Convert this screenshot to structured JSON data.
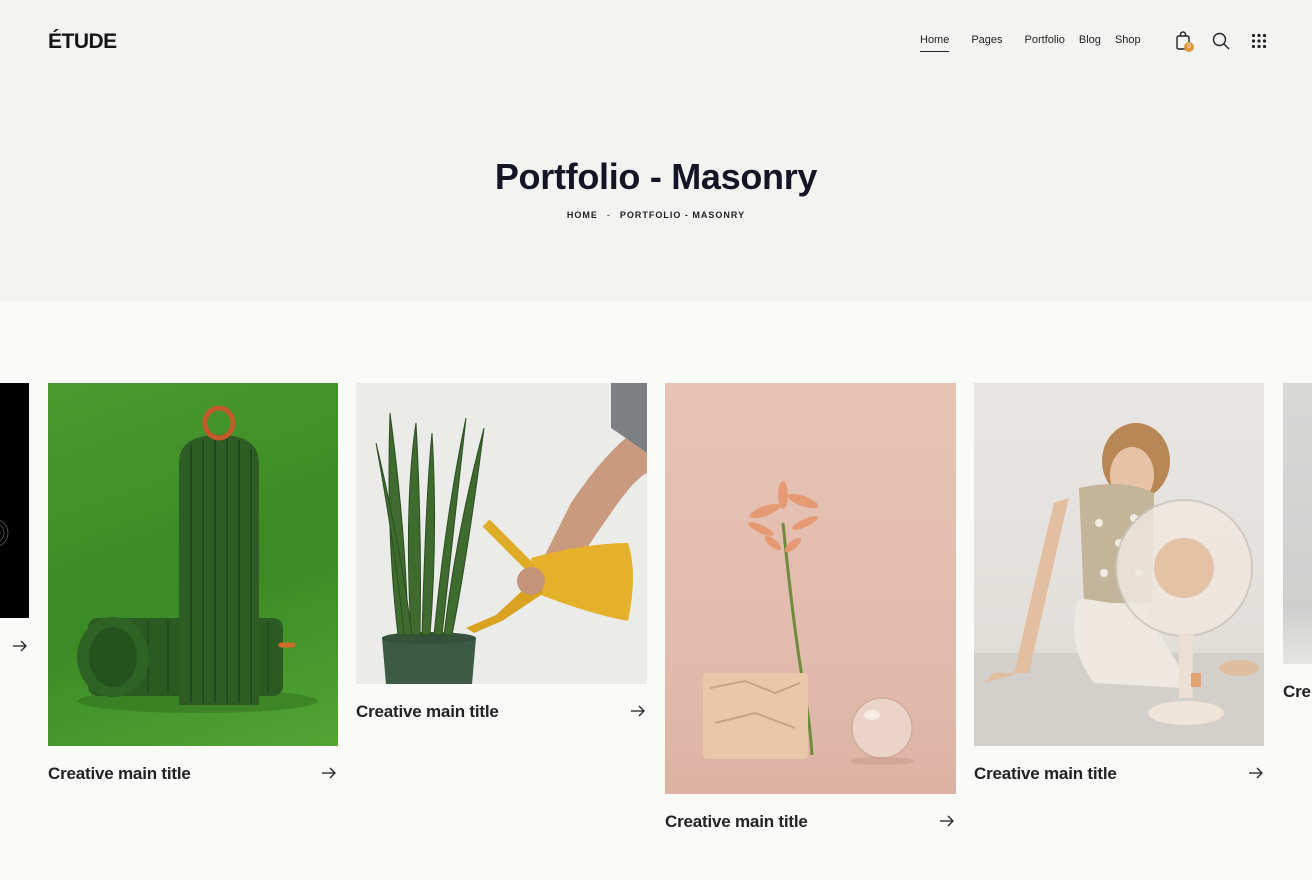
{
  "header": {
    "logo": "ÉTUDE",
    "nav": [
      {
        "label": "Home",
        "active": true
      },
      {
        "label": "Pages",
        "active": false
      },
      {
        "label": "Portfolio",
        "active": false
      },
      {
        "label": "Blog",
        "active": false
      },
      {
        "label": "Shop",
        "active": false
      }
    ],
    "cart_count": "0",
    "icons": [
      "shopping-bag-icon",
      "search-icon",
      "grid-menu-icon"
    ],
    "accent_color": "#e0963a"
  },
  "hero": {
    "title": "Portfolio - Masonry",
    "breadcrumb": [
      "HOME",
      "PORTFOLIO - MASONRY"
    ],
    "separator": "-"
  },
  "portfolio": {
    "items": [
      {
        "title": "",
        "image": "dark-abstract-photo"
      },
      {
        "title": "Creative main title",
        "image": "green-ribbed-objects-photo"
      },
      {
        "title": "Creative main title",
        "image": "snake-plant-watering-can-photo"
      },
      {
        "title": "Creative main title",
        "image": "flower-stone-glass-sphere-photo"
      },
      {
        "title": "Creative main title",
        "image": "woman-with-fan-photo"
      },
      {
        "title": "Cre",
        "image": "partial-gray-photo"
      }
    ]
  }
}
